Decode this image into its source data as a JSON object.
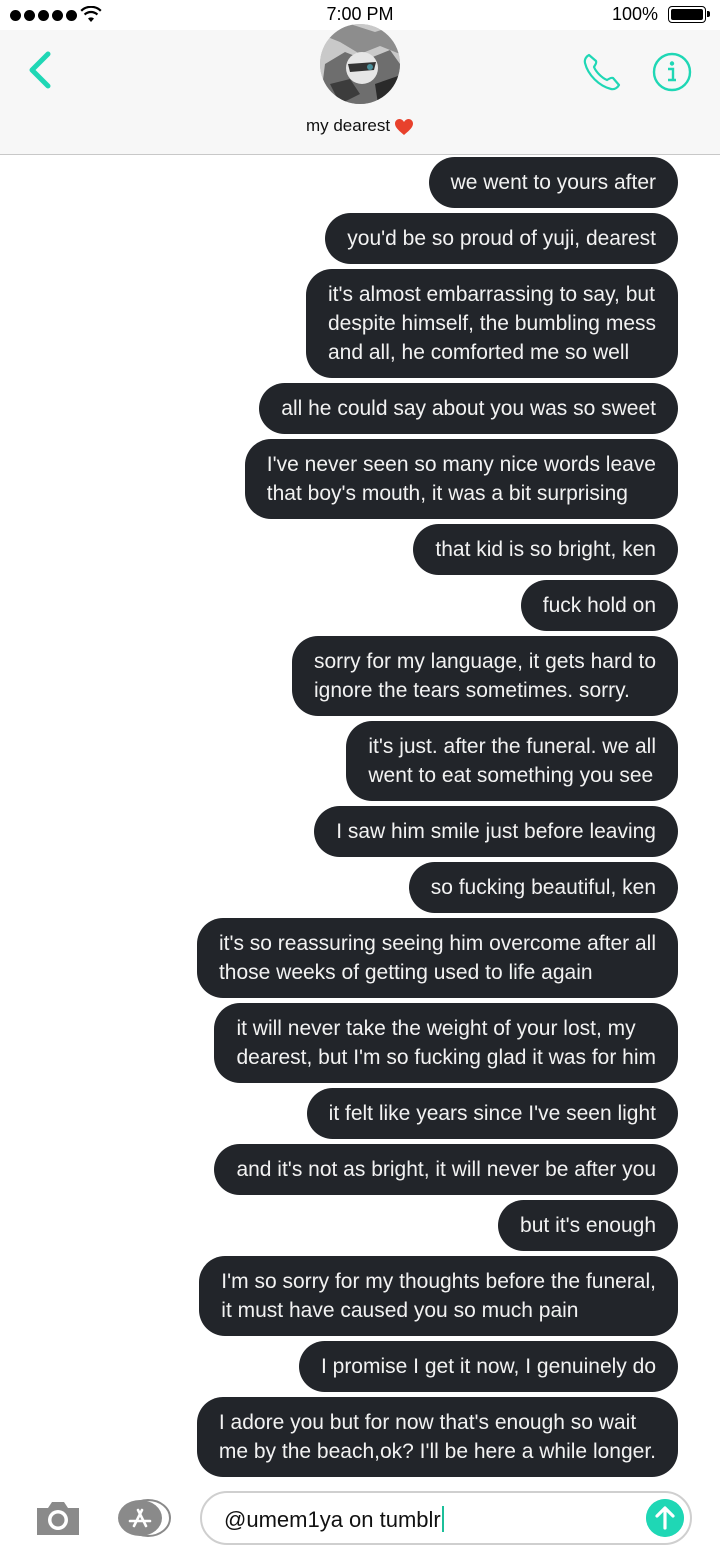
{
  "status_bar": {
    "time": "7:00 PM",
    "battery": "100%"
  },
  "header": {
    "contact_name": "my dearest"
  },
  "colors": {
    "accent": "#1fd7b5",
    "bubble": "#22252a",
    "bubble_text": "#f2f2f2"
  },
  "icons": {
    "back": "chevron-left-icon",
    "call": "phone-icon",
    "info": "info-icon",
    "camera": "camera-icon",
    "apps": "app-store-icon",
    "send": "send-arrow-icon",
    "heart": "heart-icon"
  },
  "messages": [
    "we went to yours after",
    "you'd be so proud of yuji, dearest",
    "it's almost embarrassing to say, but\ndespite himself, the bumbling mess\nand all, he comforted me so well",
    "all he could say about you was so sweet",
    "I've never seen so many nice words leave\nthat boy's mouth, it was a bit surprising",
    "that kid is so bright, ken",
    "fuck hold on",
    "sorry for my language, it gets hard to\nignore the tears sometimes. sorry.",
    "it's just. after the funeral. we all\nwent to eat something you see",
    "I saw him smile just before leaving",
    "so fucking beautiful, ken",
    "it's so reassuring seeing him overcome after all\nthose weeks of getting used to life again",
    "it will never take the weight of your lost, my\ndearest, but I'm so fucking glad it was for him",
    "it felt like years since I've seen light",
    "and it's not as bright, it will never be after you",
    "but it's enough",
    "I'm so sorry for my thoughts before the funeral,\nit must have caused you so much pain",
    "I promise I get it now, I genuinely do",
    "I adore you but for now that's enough so wait\nme by the beach,ok? I'll be here a while longer."
  ],
  "composer": {
    "value": "@umem1ya on tumblr"
  }
}
